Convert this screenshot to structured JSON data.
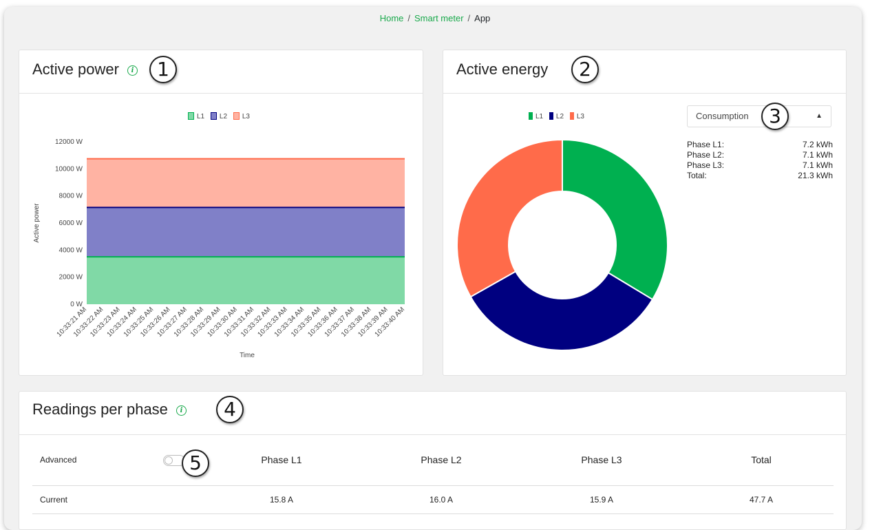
{
  "breadcrumb": {
    "home": "Home",
    "smart_meter": "Smart meter",
    "current": "App"
  },
  "callouts": [
    "1",
    "2",
    "3",
    "4",
    "5"
  ],
  "colors": {
    "l1": "#00b050",
    "l2": "#000080",
    "l3": "#ff6b4a",
    "accent": "#19a94b"
  },
  "power_card": {
    "title": "Active power",
    "legend": [
      "L1",
      "L2",
      "L3"
    ],
    "chart_data": {
      "type": "area",
      "stacked": true,
      "xlabel": "Time",
      "ylabel": "Active power",
      "ylim": [
        0,
        12000
      ],
      "y_ticks": [
        "0 W",
        "2000 W",
        "4000 W",
        "6000 W",
        "8000 W",
        "10000 W",
        "12000 W"
      ],
      "x": [
        "10:33:21 AM",
        "10:33:22 AM",
        "10:33:23 AM",
        "10:33:24 AM",
        "10:33:25 AM",
        "10:33:26 AM",
        "10:33:27 AM",
        "10:33:28 AM",
        "10:33:29 AM",
        "10:33:30 AM",
        "10:33:31 AM",
        "10:33:32 AM",
        "10:33:33 AM",
        "10:33:34 AM",
        "10:33:35 AM",
        "10:33:36 AM",
        "10:33:37 AM",
        "10:33:38 AM",
        "10:33:39 AM",
        "10:33:40 AM"
      ],
      "series": [
        {
          "name": "L1",
          "values": [
            3500,
            3500,
            3500,
            3500,
            3500,
            3500,
            3500,
            3500,
            3500,
            3500,
            3500,
            3500,
            3500,
            3500,
            3500,
            3500,
            3500,
            3500,
            3500,
            3500
          ]
        },
        {
          "name": "L2",
          "values": [
            3650,
            3650,
            3650,
            3650,
            3650,
            3650,
            3650,
            3650,
            3650,
            3650,
            3650,
            3650,
            3650,
            3650,
            3650,
            3650,
            3650,
            3650,
            3650,
            3650
          ]
        },
        {
          "name": "L3",
          "values": [
            3600,
            3600,
            3600,
            3600,
            3600,
            3600,
            3600,
            3600,
            3600,
            3600,
            3600,
            3600,
            3600,
            3600,
            3600,
            3600,
            3600,
            3600,
            3600,
            3600
          ]
        }
      ],
      "legend_position": "top"
    }
  },
  "energy_card": {
    "title": "Active energy",
    "legend": [
      "L1",
      "L2",
      "L3"
    ],
    "select_value": "Consumption",
    "rows": [
      {
        "label": "Phase L1:",
        "value": "7.2 kWh"
      },
      {
        "label": "Phase L2:",
        "value": "7.1 kWh"
      },
      {
        "label": "Phase L3:",
        "value": "7.1 kWh"
      },
      {
        "label": "Total:",
        "value": "21.3 kWh"
      }
    ],
    "chart_data": {
      "type": "pie",
      "donut": true,
      "categories": [
        "L1",
        "L2",
        "L3"
      ],
      "values": [
        7.2,
        7.1,
        7.1
      ],
      "legend_position": "top"
    }
  },
  "readings_card": {
    "title": "Readings per phase",
    "advanced_label": "Advanced",
    "advanced_on": false,
    "columns": [
      "Phase L1",
      "Phase L2",
      "Phase L3",
      "Total"
    ],
    "rows": [
      {
        "label": "Current",
        "values": [
          "15.8 A",
          "16.0 A",
          "15.9 A",
          "47.7 A"
        ]
      }
    ]
  }
}
